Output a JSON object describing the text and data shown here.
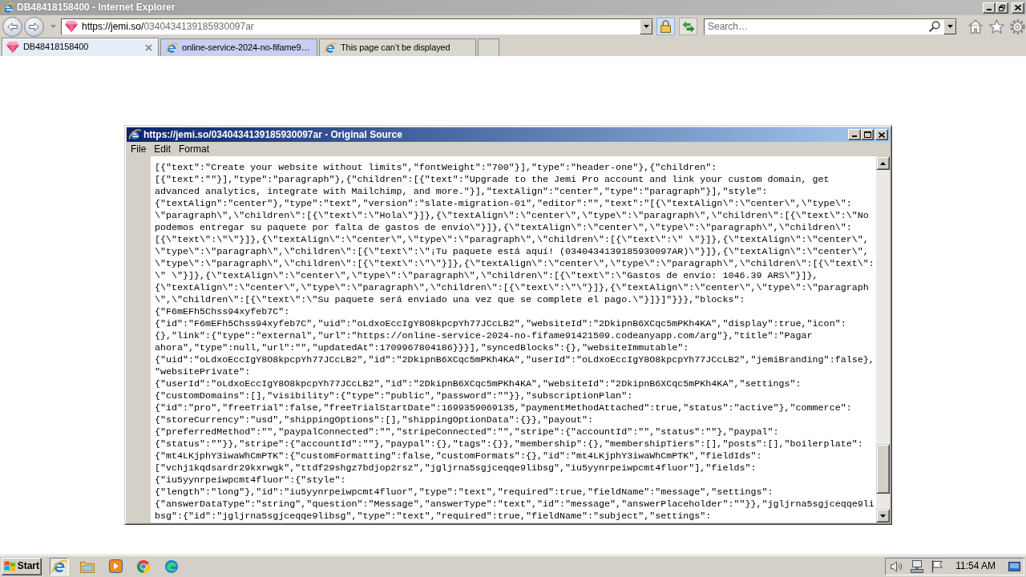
{
  "browser": {
    "title": "DB48418158400 - Internet Explorer",
    "address": {
      "host": "https://jemi.so/",
      "path": "0340434139185930097ar"
    },
    "search": {
      "placeholder": "Search…"
    },
    "tabs": [
      {
        "label": "DB48418158400",
        "kind": "site",
        "selected": true,
        "color": "#e6ecf8"
      },
      {
        "label": "online-service-2024-no-fifame9…",
        "kind": "browser",
        "selected": false,
        "color": "#c9cff0"
      },
      {
        "label": "This page can’t be displayed",
        "kind": "browser",
        "selected": false,
        "color": "#dad7d0"
      }
    ]
  },
  "source_window": {
    "title": "https://jemi.so/0340434139185930097ar - Original Source",
    "menu": [
      "File",
      "Edit",
      "Format"
    ],
    "lines": [
      "[{\"text\":\"Create your website without limits\",\"fontWeight\":\"700\"}],\"type\":\"header-one\"},{\"children\":",
      "[{\"text\":\"\"}],\"type\":\"paragraph\"},{\"children\":[{\"text\":\"Upgrade to the Jemi Pro account and link your custom domain, get",
      "advanced analytics, integrate with Mailchimp, and more.\"}],\"textAlign\":\"center\",\"type\":\"paragraph\"}],\"style\":",
      "{\"textAlign\":\"center\"},\"type\":\"text\",\"version\":\"slate-migration-01\",\"editor\":\"\",\"text\":\"[{\\\"textAlign\\\":\\\"center\\\",\\\"type\\\":",
      "\\\"paragraph\\\",\\\"children\\\":[{\\\"text\\\":\\\"Hola\\\"}]},{\\\"textAlign\\\":\\\"center\\\",\\\"type\\\":\\\"paragraph\\\",\\\"children\\\":[{\\\"text\\\":\\\"No",
      "podemos entregar su paquete por falta de gastos de envío\\\"}]},{\\\"textAlign\\\":\\\"center\\\",\\\"type\\\":\\\"paragraph\\\",\\\"children\\\":",
      "[{\\\"text\\\":\\\"\\\"}]},{\\\"textAlign\\\":\\\"center\\\",\\\"type\\\":\\\"paragraph\\\",\\\"children\\\":[{\\\"text\\\":\\\" \\\"}]},{\\\"textAlign\\\":\\\"center\\\",",
      "\\\"type\\\":\\\"paragraph\\\",\\\"children\\\":[{\\\"text\\\":\\\"¡Tu paquete está aquí! (0340434139185930097AR)\\\"}]},{\\\"textAlign\\\":\\\"center\\\",",
      "\\\"type\\\":\\\"paragraph\\\",\\\"children\\\":[{\\\"text\\\":\\\"\\\"}]},{\\\"textAlign\\\":\\\"center\\\",\\\"type\\\":\\\"paragraph\\\",\\\"children\\\":[{\\\"text\\\":",
      "\\\" \\\"}]},{\\\"textAlign\\\":\\\"center\\\",\\\"type\\\":\\\"paragraph\\\",\\\"children\\\":[{\\\"text\\\":\\\"Gastos de envío: 1046.39 ARS\\\"}]},",
      "{\\\"textAlign\\\":\\\"center\\\",\\\"type\\\":\\\"paragraph\\\",\\\"children\\\":[{\\\"text\\\":\\\"\\\"}]},{\\\"textAlign\\\":\\\"center\\\",\\\"type\\\":\\\"paragraph",
      "\\\",\\\"children\\\":[{\\\"text\\\":\\\"Su paquete será enviado una vez que se complete el pago.\\\"}]}]\"}}},\"blocks\":",
      "{\"F6mEFh5Chss94xyfeb7C\":",
      "{\"id\":\"F6mEFh5Chss94xyfeb7C\",\"uid\":\"oLdxoEccIgY8O8kpcpYh77JCcLB2\",\"websiteId\":\"2DkipnB6XCqc5mPKh4KA\",\"display\":true,\"icon\":",
      "{},\"link\":{\"type\":\"external\",\"url\":\"https://online-service-2024-no-fifame91421509.codeanyapp.com/arg\"},\"title\":\"Pagar",
      "ahora\",\"type\":null,\"url\":\"\",\"updatedAt\":1709967804186}}}],\"syncedBlocks\":{},\"websiteImmutable\":",
      "{\"uid\":\"oLdxoEccIgY8O8kpcpYh77JCcLB2\",\"id\":\"2DkipnB6XCqc5mPKh4KA\",\"userId\":\"oLdxoEccIgY8O8kpcpYh77JCcLB2\",\"jemiBranding\":false},",
      "\"websitePrivate\":",
      "{\"userId\":\"oLdxoEccIgY8O8kpcpYh77JCcLB2\",\"id\":\"2DkipnB6XCqc5mPKh4KA\",\"websiteId\":\"2DkipnB6XCqc5mPKh4KA\",\"settings\":",
      "{\"customDomains\":[],\"visibility\":{\"type\":\"public\",\"password\":\"\"}},\"subscriptionPlan\":",
      "{\"id\":\"pro\",\"freeTrial\":false,\"freeTrialStartDate\":1699359069135,\"paymentMethodAttached\":true,\"status\":\"active\"},\"commerce\":",
      "{\"storeCurrency\":\"usd\",\"shippingOptions\":[],\"shippingOptionData\":{}},\"payout\":",
      "{\"preferredMethod\":\"\",\"paypalConnected\":\"\",\"stripeConnected\":\"\",\"stripe\":{\"accountId\":\"\",\"status\":\"\"},\"paypal\":",
      "{\"status\":\"\"}},\"stripe\":{\"accountId\":\"\"},\"paypal\":{},\"tags\":{}},\"membership\":{},\"membershipTiers\":[],\"posts\":[],\"boilerplate\":",
      "{\"mt4LKjphY3iwaWhCmPTK\":{\"customFormatting\":false,\"customFormats\":{},\"id\":\"mt4LKjphY3iwaWhCmPTK\",\"fieldIds\":",
      "[\"vchj1kqdsardr29kxrwgk\",\"ttdf29shgz7bdjop2rsz\",\"jgljrna5sgjceqqe9libsg\",\"iu5yynrpeiwpcmt4fluor\"],\"fields\":",
      "{\"iu5yynrpeiwpcmt4fluor\":{\"style\":",
      "{\"length\":\"long\"},\"id\":\"iu5yynrpeiwpcmt4fluor\",\"type\":\"text\",\"required\":true,\"fieldName\":\"message\",\"settings\":",
      "{\"answerDataType\":\"string\",\"question\":\"Message\",\"answerType\":\"text\",\"id\":\"message\",\"answerPlaceholder\":\"\"}},\"jgljrna5sgjceqqe9li",
      "bsg\":{\"id\":\"jgljrna5sgjceqqe9libsg\",\"type\":\"text\",\"required\":true,\"fieldName\":\"subject\",\"settings\":"
    ]
  },
  "taskbar": {
    "start": "Start",
    "apps": [
      {
        "kind": "ie",
        "active": true
      },
      {
        "kind": "folder",
        "active": false
      },
      {
        "kind": "player",
        "active": false
      },
      {
        "kind": "chrome",
        "active": false
      },
      {
        "kind": "edge",
        "active": false
      }
    ],
    "clock": "11:54 AM"
  }
}
